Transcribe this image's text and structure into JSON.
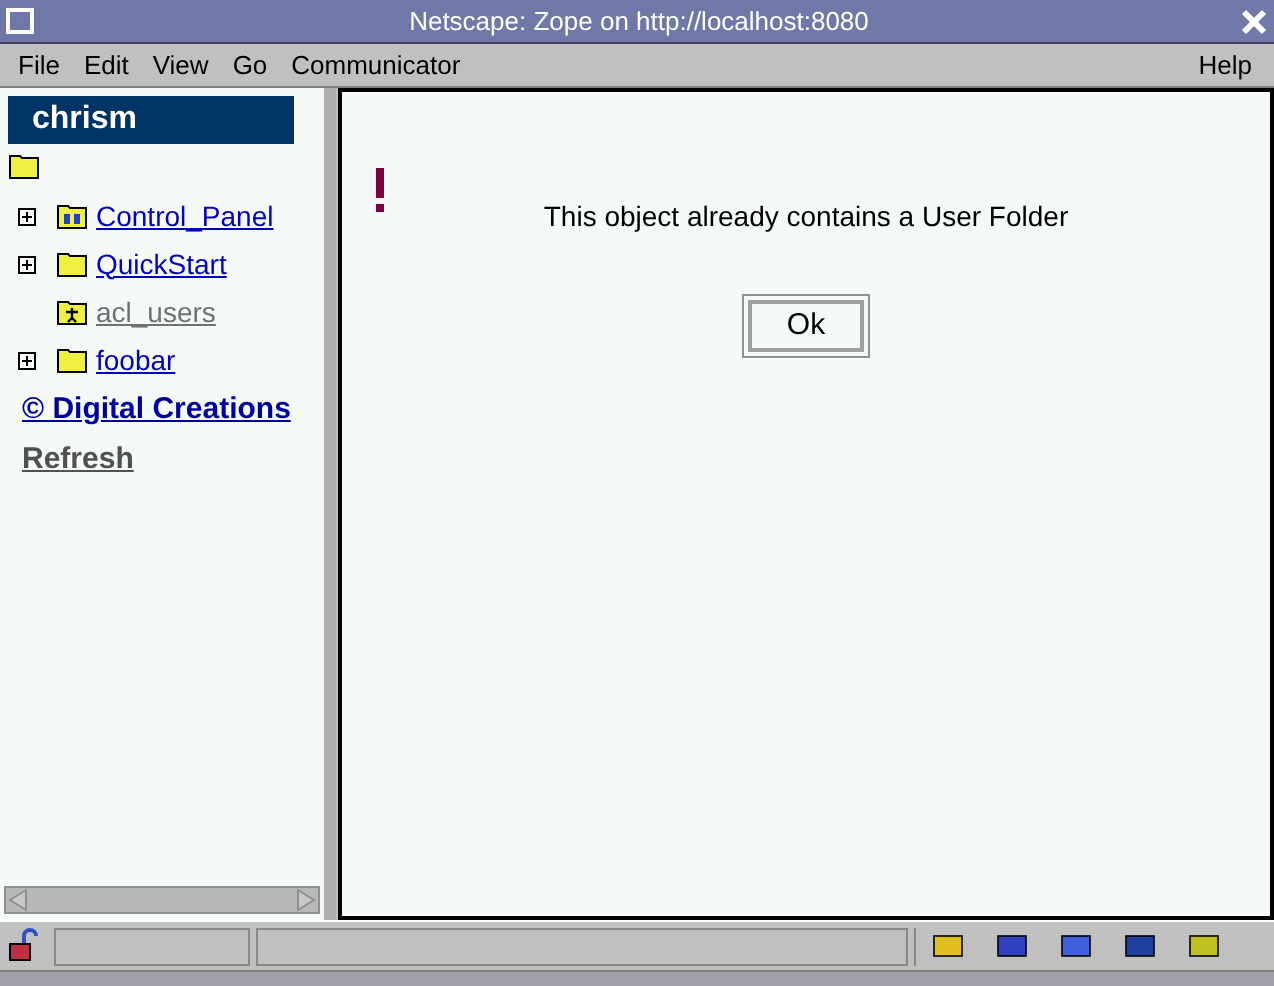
{
  "window": {
    "title": "Netscape: Zope on http://localhost:8080"
  },
  "menu": [
    {
      "label": "File"
    },
    {
      "label": "Edit"
    },
    {
      "label": "View"
    },
    {
      "label": "Go"
    },
    {
      "label": "Communicator"
    }
  ],
  "help_menu": {
    "label": "Help"
  },
  "sidebar": {
    "title": "chrism",
    "items": [
      {
        "label": "Control_Panel",
        "kind": "control",
        "expandable": true,
        "visited": false
      },
      {
        "label": "QuickStart",
        "kind": "folder",
        "expandable": true,
        "visited": false
      },
      {
        "label": "acl_users",
        "kind": "users",
        "expandable": false,
        "visited": true
      },
      {
        "label": "foobar",
        "kind": "folder",
        "expandable": true,
        "visited": false
      }
    ],
    "links": [
      {
        "label": "© Digital Creations",
        "visited": false
      },
      {
        "label": "Refresh",
        "visited": true
      }
    ]
  },
  "message": {
    "text": "This object already contains a User Folder",
    "button": "Ok"
  }
}
